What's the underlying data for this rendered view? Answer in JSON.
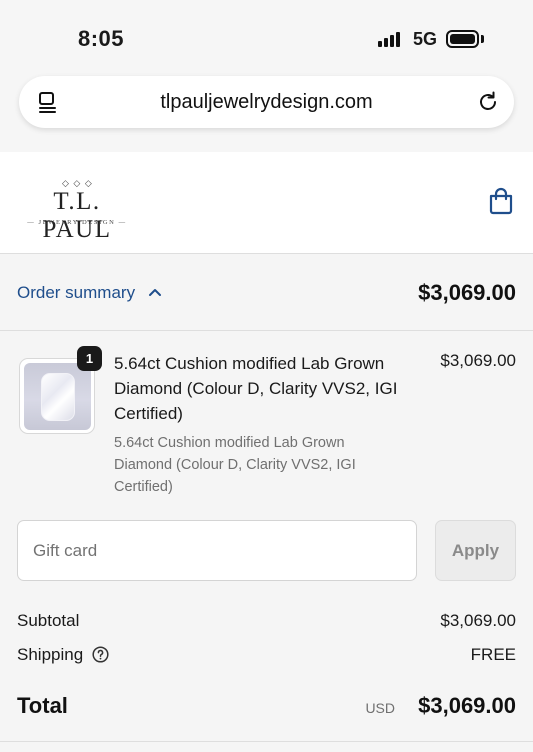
{
  "status_bar": {
    "time": "8:05",
    "network": "5G"
  },
  "browser": {
    "url": "tlpauljewelrydesign.com",
    "reader_icon": "reader-mode-icon",
    "reload_icon": "reload-icon"
  },
  "header": {
    "logo_name": "T.L. PAUL",
    "logo_sub": "— JEWELRY DESIGN —",
    "cart_icon": "shopping-bag-icon"
  },
  "summary": {
    "toggle_label": "Order summary",
    "total": "$3,069.00"
  },
  "product": {
    "quantity": "1",
    "title": "5.64ct Cushion modified Lab Grown Diamond (Colour D, Clarity VVS2, IGI Certified)",
    "subtitle": "5.64ct Cushion modified Lab Grown Diamond (Colour D, Clarity VVS2, IGI Certified)",
    "price": "$3,069.00"
  },
  "gift_card": {
    "placeholder": "Gift card",
    "value": "",
    "apply_label": "Apply"
  },
  "totals": {
    "subtotal_label": "Subtotal",
    "subtotal_value": "$3,069.00",
    "shipping_label": "Shipping",
    "shipping_value": "FREE",
    "total_label": "Total",
    "currency": "USD",
    "total_value": "$3,069.00"
  },
  "colors": {
    "link_blue": "#1f4e8c",
    "panel_bg": "#f5f5f5"
  }
}
